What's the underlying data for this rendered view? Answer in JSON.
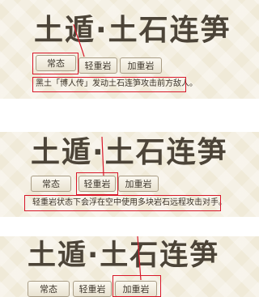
{
  "skill_name": "土遁·土石连笋",
  "tabs": {
    "normal": "常态",
    "light_rock": "轻重岩",
    "heavy_rock": "加重岩"
  },
  "descriptions": {
    "normal": "黑土「博人传」发动土石连笋攻击前方敌人。",
    "light_rock": "轻重岩状态下会浮在空中使用多块岩石远程攻击对手。"
  },
  "colors": {
    "panel_bg": "#f0ead8",
    "title_text": "#4c4438",
    "highlight": "#d8182a"
  }
}
